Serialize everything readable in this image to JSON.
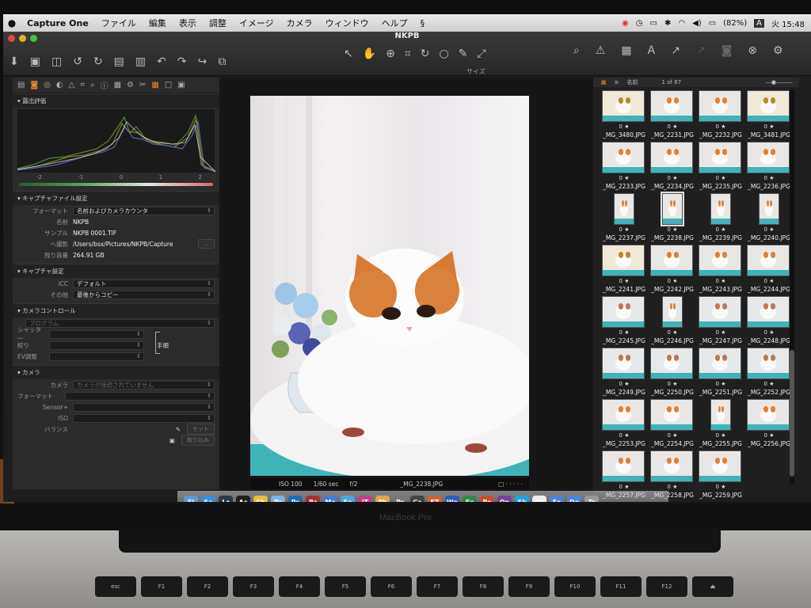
{
  "menubar": {
    "apple": "",
    "app_name": "Capture One",
    "menus": [
      "ファイル",
      "編集",
      "表示",
      "調整",
      "イメージ",
      "カメラ",
      "ウィンドウ",
      "ヘルプ"
    ],
    "battery": "(82%)",
    "input_mode": "A",
    "clock": "火 15:48"
  },
  "window": {
    "title": "NKPB"
  },
  "toolbar": {
    "size_label": "サイズ"
  },
  "left_panel": {
    "exposure_header": "露出評価",
    "histogram_ticks": [
      "-2",
      "-1",
      "0",
      "1",
      "2"
    ],
    "capture_settings_header": "キャプチャファイル設定",
    "format_label": "フォーマット",
    "format_value": "名前およびカメラカウンタ",
    "name_label": "名前",
    "name_value": "NKPB",
    "sample_label": "サンプル",
    "sample_value": "NKPB 0001.TIF",
    "dest_label": "へ撮影",
    "dest_value": "/Users/bsx/Pictures/NKPB/Capture",
    "space_label": "残り容量",
    "space_value": "264.91 GB",
    "capture_header": "キャプチャ設定",
    "icc_label": "ICC",
    "icc_value": "デフォルト",
    "other_label": "その他",
    "other_value": "最後からコピー",
    "camera_control_header": "カメラコントロール",
    "program_value": "プログラム",
    "shutter_label": "シャッター",
    "aperture_label": "絞り",
    "ev_label": "EV調整",
    "manual_label": "手順",
    "camera_header": "カメラ",
    "camera_label": "カメラ",
    "camera_value": "カメラが接続されていません",
    "fmt_label": "フォーマット",
    "sensor_label": "Sensor+",
    "iso_label": "ISO",
    "balance_label": "バランス",
    "set_button": "セット",
    "load_button": "取り込み"
  },
  "viewer": {
    "iso": "ISO 100",
    "shutter": "1/60 sec",
    "aperture": "f/2",
    "filename": "_MG_2238.JPG"
  },
  "browser": {
    "sort_label": "名前",
    "count_label": "1 of 87",
    "thumbnails": [
      {
        "name": "_MG_3480.JPG",
        "rating": "0 ★",
        "kind": "toy"
      },
      {
        "name": "_MG_2231.JPG",
        "rating": "0 ★",
        "kind": "cat"
      },
      {
        "name": "_MG_2232.JPG",
        "rating": "0 ★",
        "kind": "cat"
      },
      {
        "name": "_MG_3481.JPG",
        "rating": "0 ★",
        "kind": "toy"
      },
      {
        "name": "_MG_2233.JPG",
        "rating": "0 ★",
        "kind": "cat"
      },
      {
        "name": "_MG_2234.JPG",
        "rating": "0 ★",
        "kind": "cat"
      },
      {
        "name": "_MG_2235.JPG",
        "rating": "0 ★",
        "kind": "cat"
      },
      {
        "name": "_MG_2236.JPG",
        "rating": "0 ★",
        "kind": "cat"
      },
      {
        "name": "_MG_2237.JPG",
        "rating": "0 ★",
        "kind": "cat-portrait"
      },
      {
        "name": "_MG_2238.JPG",
        "rating": "0 ★",
        "kind": "cat-portrait-sel"
      },
      {
        "name": "_MG_2239.JPG",
        "rating": "0 ★",
        "kind": "cat-portrait"
      },
      {
        "name": "_MG_2240.JPG",
        "rating": "0 ★",
        "kind": "cat-portrait"
      },
      {
        "name": "_MG_2241.JPG",
        "rating": "0 ★",
        "kind": "toy"
      },
      {
        "name": "_MG_2242.JPG",
        "rating": "0 ★",
        "kind": "cat"
      },
      {
        "name": "_MG_2243.JPG",
        "rating": "0 ★",
        "kind": "cat"
      },
      {
        "name": "_MG_2244.JPG",
        "rating": "0 ★",
        "kind": "cat"
      },
      {
        "name": "_MG_2245.JPG",
        "rating": "0 ★",
        "kind": "dog"
      },
      {
        "name": "_MG_2246.JPG",
        "rating": "0 ★",
        "kind": "cat-portrait"
      },
      {
        "name": "_MG_2247.JPG",
        "rating": "0 ★",
        "kind": "dog"
      },
      {
        "name": "_MG_2248.JPG",
        "rating": "0 ★",
        "kind": "dog"
      },
      {
        "name": "_MG_2249.JPG",
        "rating": "0 ★",
        "kind": "dog"
      },
      {
        "name": "_MG_2250.JPG",
        "rating": "0 ★",
        "kind": "dog"
      },
      {
        "name": "_MG_2251.JPG",
        "rating": "0 ★",
        "kind": "dog"
      },
      {
        "name": "_MG_2252.JPG",
        "rating": "0 ★",
        "kind": "dog"
      },
      {
        "name": "_MG_2253.JPG",
        "rating": "0 ★",
        "kind": "cat"
      },
      {
        "name": "_MG_2254.JPG",
        "rating": "0 ★",
        "kind": "cat"
      },
      {
        "name": "_MG_2255.JPG",
        "rating": "0 ★",
        "kind": "cat-portrait"
      },
      {
        "name": "_MG_2256.JPG",
        "rating": "0 ★",
        "kind": "cat"
      },
      {
        "name": "_MG_2257.JPG",
        "rating": "0 ★",
        "kind": "cat"
      },
      {
        "name": "_MG_2258.JPG",
        "rating": "0 ★",
        "kind": "cat"
      },
      {
        "name": "_MG_2259.JPG",
        "rating": "0 ★",
        "kind": "cat"
      }
    ]
  },
  "dock": {
    "apps": [
      "Finder",
      "Safari",
      "Lr",
      "Activity",
      "Chrome",
      "Preview",
      "Ps",
      "Br",
      "Mail",
      "Safari2",
      "iTunes",
      "Photos",
      "Prefs",
      "Capture",
      "FTP",
      "Word",
      "Excel",
      "PowerPoint",
      "OneNote",
      "Skype",
      "Calendar",
      "Folder",
      "Downloads",
      "Trash"
    ]
  },
  "laptop": {
    "brand": "MacBook Pro",
    "keys": [
      "esc",
      "F1",
      "F2",
      "F3",
      "F4",
      "F5",
      "F6",
      "F7",
      "F8",
      "F9",
      "F10",
      "F11",
      "F12",
      "⏏"
    ]
  }
}
